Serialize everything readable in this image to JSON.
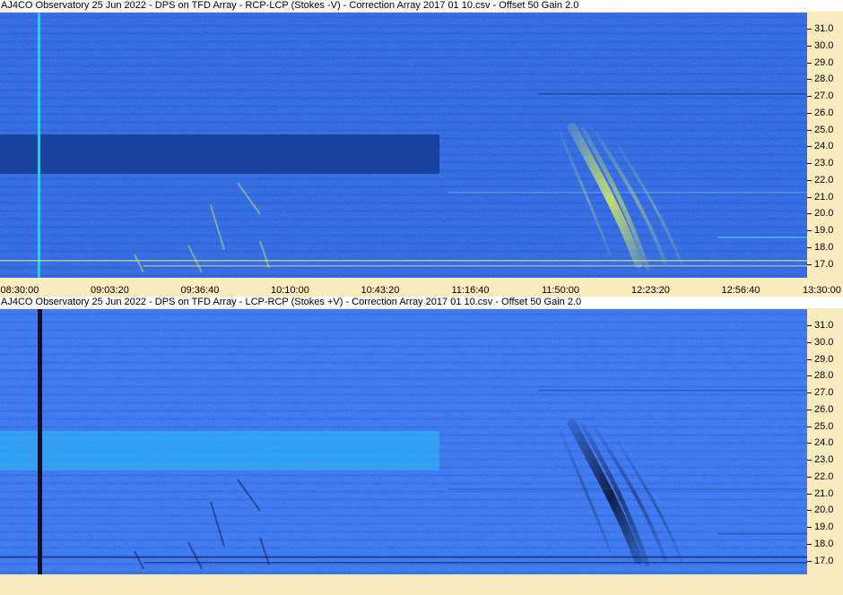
{
  "panels": [
    {
      "title": "AJ4CO Observatory 25 Jun 2022  -  DPS on TFD Array  -  RCP-LCP (Stokes -V)  -  Correction Array 2017 01 10.csv  -  Offset 50  Gain 2.0",
      "polarity": "positive",
      "colors": {
        "background": "#1e5be0",
        "band": "#14388f",
        "burst": "#d8f060",
        "marker": "#38c8f0"
      }
    },
    {
      "title": "AJ4CO Observatory 25 Jun 2022  -  DPS on TFD Array  -  LCP-RCP (Stokes +V)  -  Correction Array 2017 01 10.csv  -  Offset 50  Gain 2.0",
      "polarity": "negative",
      "colors": {
        "background": "#2a6af0",
        "band": "#2fb0f4",
        "burst": "#0a1030",
        "marker": "#050a28"
      }
    }
  ],
  "frequency_labels": [
    "31.0",
    "30.0",
    "29.0",
    "28.0",
    "27.0",
    "26.0",
    "25.0",
    "24.0",
    "23.0",
    "22.0",
    "21.0",
    "20.0",
    "19.0",
    "18.0",
    "17.0"
  ],
  "time_labels": [
    "08:30:00",
    "09:03:20",
    "09:36:40",
    "10:10:00",
    "10:43:20",
    "11:16:40",
    "11:50:00",
    "12:23:20",
    "12:56:40",
    "13:30:00"
  ]
}
